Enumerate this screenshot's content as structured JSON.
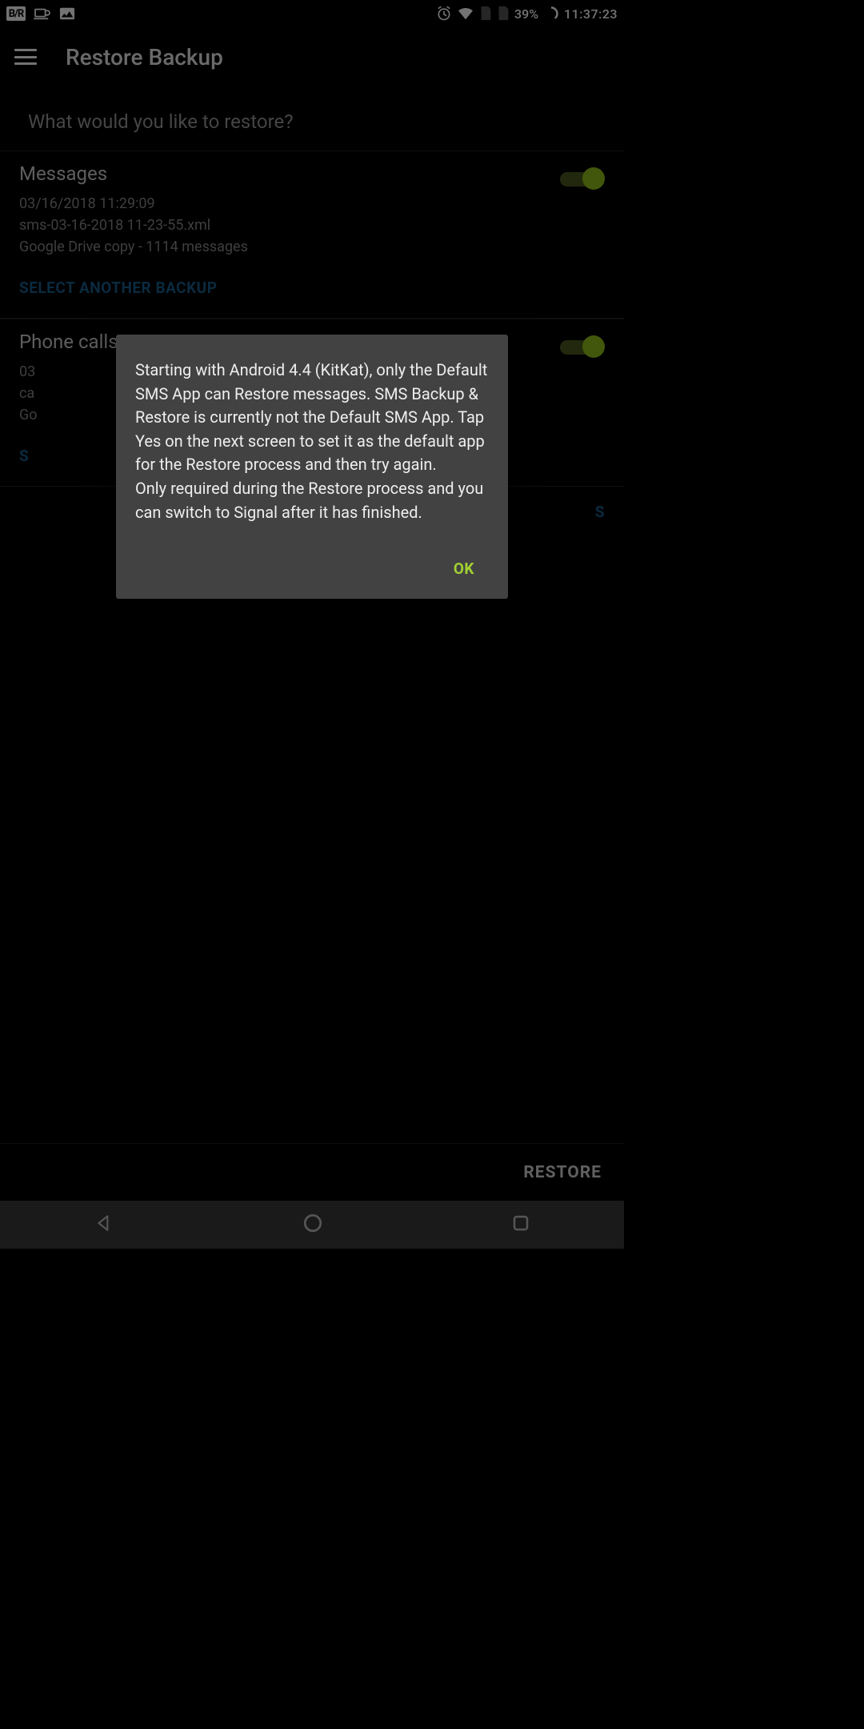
{
  "status": {
    "battery": "39%",
    "time": "11:37:23"
  },
  "appbar": {
    "title": "Restore Backup"
  },
  "subheader": "What would you like to restore?",
  "sections": [
    {
      "title": "Messages",
      "line1": "03/16/2018 11:29:09",
      "line2": "sms-03-16-2018 11-23-55.xml",
      "line3": "Google Drive copy - 1114 messages",
      "link": "SELECT ANOTHER BACKUP",
      "toggle": true
    },
    {
      "title": "Phone calls",
      "line1": "03",
      "line2": "ca",
      "line3": "Go",
      "link": "S",
      "toggle": true
    }
  ],
  "advanced_link": "S",
  "bottom": {
    "restore": "RESTORE"
  },
  "dialog": {
    "text": "Starting with Android 4.4 (KitKat), only the Default SMS App can Restore messages. SMS Backup & Restore is currently not the Default SMS App. Tap Yes on the next screen to set it as the default app for the Restore process and then try again.\nOnly required during the Restore process and you can switch to Signal after it has finished.",
    "ok": "OK"
  },
  "colors": {
    "accent": "#a3d133",
    "link": "#1a5d8c"
  }
}
